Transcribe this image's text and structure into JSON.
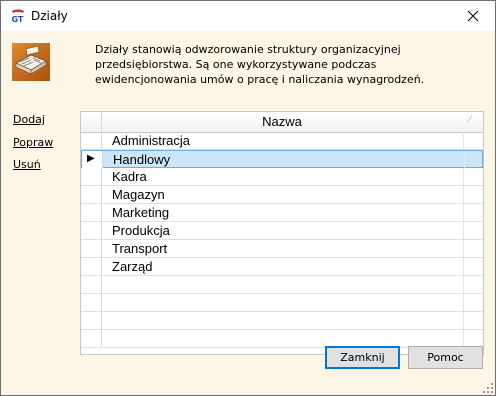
{
  "window": {
    "title": "Działy",
    "close_glyph": "✕"
  },
  "description": "Działy stanowią odwzorowanie struktury organizacyjnej przedsiębiorstwa. Są one wykorzystywane podczas ewidencjonowania umów o pracę i naliczania wynagrodzeń.",
  "actions": {
    "add": "Dodaj",
    "edit": "Popraw",
    "delete": "Usuń"
  },
  "grid": {
    "column": "Nazwa",
    "current_row_marker": "▶",
    "rows": [
      "Administracja",
      "Handlowy",
      "Kadra",
      "Magazyn",
      "Marketing",
      "Produkcja",
      "Transport",
      "Zarząd"
    ],
    "selected_row": "Handlowy"
  },
  "buttons": {
    "close": "Zamknij",
    "help": "Pomoc"
  },
  "colors": {
    "client_bg": "#fdf5e6",
    "selection": "#cde6f7",
    "selection_border": "#6aaee0",
    "default_button_border": "#0078d7"
  }
}
